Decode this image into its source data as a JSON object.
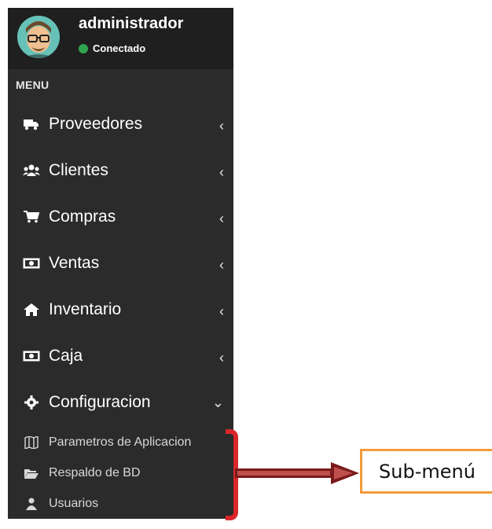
{
  "user": {
    "name": "administrador",
    "status": "Conectado",
    "status_color": "#2ea44f"
  },
  "menu": {
    "header": "MENU",
    "items": [
      {
        "label": "Proveedores",
        "icon": "truck-icon",
        "expanded": false
      },
      {
        "label": "Clientes",
        "icon": "users-icon",
        "expanded": false
      },
      {
        "label": "Compras",
        "icon": "cart-icon",
        "expanded": false
      },
      {
        "label": "Ventas",
        "icon": "money-icon",
        "expanded": false
      },
      {
        "label": "Inventario",
        "icon": "home-icon",
        "expanded": false
      },
      {
        "label": "Caja",
        "icon": "money-icon",
        "expanded": false
      },
      {
        "label": "Configuracion",
        "icon": "gear-icon",
        "expanded": true
      }
    ],
    "submenu": [
      {
        "label": "Parametros de Aplicacion",
        "icon": "map-icon"
      },
      {
        "label": "Respaldo de BD",
        "icon": "folder-open-icon"
      },
      {
        "label": "Usuarios",
        "icon": "user-icon"
      }
    ]
  },
  "annotation": {
    "label": "Sub-menú",
    "bracket_color": "#d9262a",
    "arrow_color": "#7a1a1a",
    "box_color": "#f39b3a"
  },
  "colors": {
    "sidebar_bg": "#2b2b2b",
    "user_panel_bg": "#1f1f1f"
  }
}
